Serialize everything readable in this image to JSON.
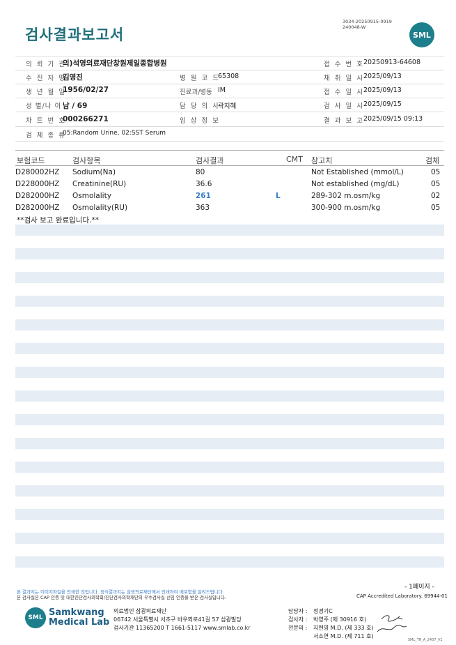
{
  "report": {
    "title": "검사결과보고서",
    "doc_id_line1": "3034-20250915-0919",
    "doc_id_line2": "240048-W",
    "logo_text": "SML"
  },
  "info": {
    "hospital_label": "의 뢰 기 관",
    "hospital_value": "의)석영의료재단창원제일종합병원",
    "receipt_no_label": "접 수 번 호",
    "receipt_no_value": "20250913-64608",
    "patient_label": "수 진 자 명",
    "patient_value": "김영진",
    "hosp_code_label": "병 원 코 드",
    "hosp_code_value": "65308",
    "collect_date_label": "채 취 일 시",
    "collect_date_value": "2025/09/13",
    "birth_label": "생 년 월 일",
    "birth_value": "1956/02/27",
    "dept_label": "진료과/병동",
    "dept_value": "IM",
    "receipt_date_label": "접 수 일 시",
    "receipt_date_value": "2025/09/13",
    "sex_age_label": "성 별/나 이",
    "sex_age_value": "남 / 69",
    "doctor_label": "담 당 의 사",
    "doctor_value": "곽지혜",
    "test_date_label": "검 사 일 시",
    "test_date_value": "2025/09/15",
    "chart_no_label": "차 트 번 호",
    "chart_no_value": "000266271",
    "clinical_label": "임 상 정 보",
    "clinical_value": "",
    "report_date_label": "결 과 보 고",
    "report_date_value": "2025/09/15 09:13",
    "specimen_type_label": "검 체 종 류",
    "specimen_type_value": "05:Random Urine, 02:SST Serum"
  },
  "table": {
    "headers": {
      "code": "보험코드",
      "item": "검사항목",
      "result": "검사결과",
      "cmt": "CMT",
      "ref": "참고치",
      "specimen": "검체"
    },
    "rows": [
      {
        "code": "D280002HZ",
        "item": "Sodium(Na)",
        "result": "80",
        "flag": "",
        "ref": "Not Established (mmol/L)",
        "specimen": "05"
      },
      {
        "code": "D228000HZ",
        "item": "Creatinine(RU)",
        "result": "36.6",
        "flag": "",
        "ref": "Not established (mg/dL)",
        "specimen": "05"
      },
      {
        "code": "D282000HZ",
        "item": "Osmolality",
        "result": "261",
        "flag": "L",
        "ref": "289-302 m.osm/kg",
        "specimen": "02"
      },
      {
        "code": "D282000HZ",
        "item": "Osmolality(RU)",
        "result": "363",
        "flag": "",
        "ref": "300-900 m.osm/kg",
        "specimen": "05"
      }
    ],
    "completion_note": "**검사 보고 완료입니다.**"
  },
  "footer": {
    "notice_blue": "본 결과지는 이미지파일을 인쇄한 것입니다. 정식결과지는 삼광의료재단에서 인쇄하여 배포함을 알려드립니다.",
    "notice_black": "본 검사실은 CAP 인증 및 대한진단검사의학회/진단검사의학재단의 우수검사실 신임 인증을 받은 검사실입니다.",
    "page": "- 1페이지 -",
    "cap": "CAP Accredited Laboratory. 69944-01",
    "lab_name_line1": "Samkwang",
    "lab_name_line2": "Medical Lab",
    "lab_logo": "SML",
    "org_line1": "의료법인 삼광의료재단",
    "org_line2": "06742 서울특별시 서초구 바우뫼로41길 57 삼광빌딩",
    "org_line3": "검사기관 11365200 T 1661-5117 www.smlab.co.kr",
    "staff_label": "담당자 :",
    "staff_value": "정경기C",
    "tester_label": "검사자 :",
    "tester_value": "박영주 (제 30916 호)",
    "specialist_label": "전문의 :",
    "specialist1": "지현영 M.D. (제 333 호)",
    "specialist2": "서소연 M.D. (제 711 호)",
    "form_code": "SML_TR_A_2407_V1"
  }
}
